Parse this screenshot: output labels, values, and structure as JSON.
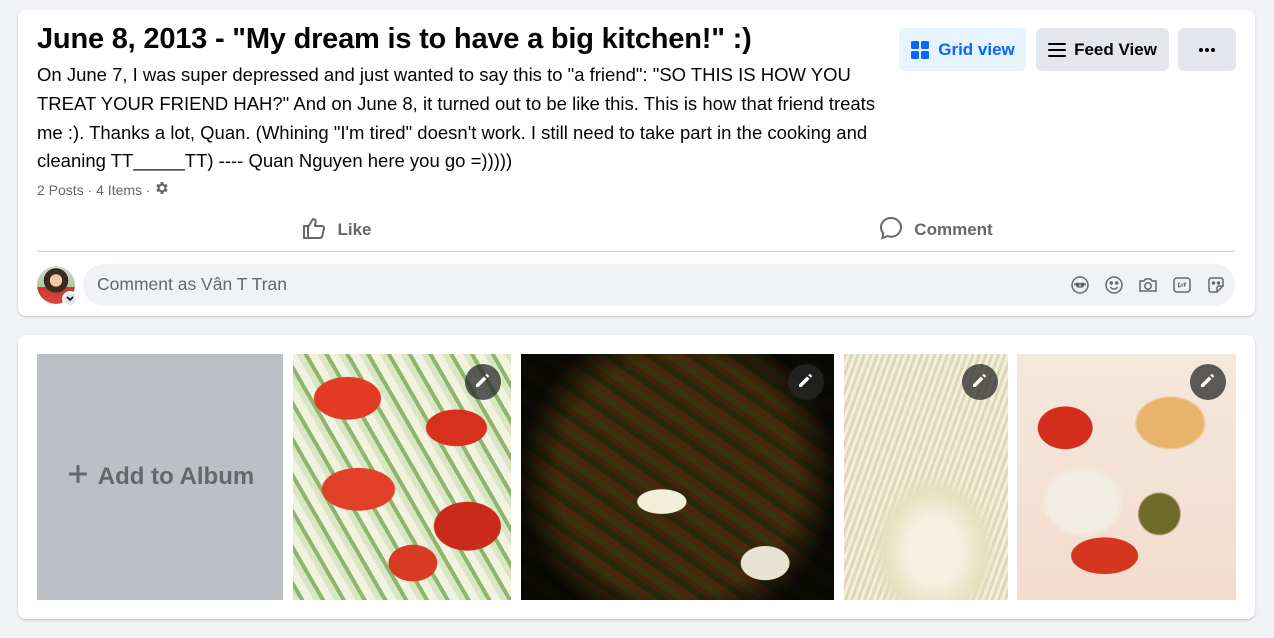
{
  "album": {
    "title": "June 8, 2013 - \"My dream is to have a big kitchen!\" :)",
    "description": "On June 7, I was super depressed and just wanted to say this to \"a friend\": \"SO THIS IS HOW YOU TREAT YOUR FRIEND HAH?\" And on June 8, it turned out to be like this. This is how that friend treats me :). Thanks a lot, Quan. (Whining \"I'm tired\" doesn't work. I still need to take part in the cooking and cleaning TT_____TT) ---- Quan Nguyen here you go =)))))",
    "meta": "2 Posts · 4 Items ·"
  },
  "view_buttons": {
    "grid": "Grid view",
    "feed": "Feed View"
  },
  "actions": {
    "like": "Like",
    "comment": "Comment"
  },
  "comment_box": {
    "placeholder": "Comment as Vân T Tran"
  },
  "grid": {
    "add_label": "Add to Album"
  },
  "icons": {
    "grid_view": "grid-icon",
    "feed_view": "list-icon",
    "more": "more-dots-icon",
    "like": "thumbs-up-icon",
    "comment": "comment-bubble-icon",
    "settings": "gear-icon",
    "avatar_chevron": "chevron-down-icon",
    "comment_tools": [
      "avatar-sticker-icon",
      "emoji-icon",
      "camera-icon",
      "gif-icon",
      "sticker-icon"
    ],
    "edit": "pencil-icon",
    "add": "plus-icon"
  },
  "colors": {
    "accent": "#0866ff",
    "accent_bg": "#e7f3ff",
    "secondary_text": "#65676b",
    "button_bg": "#e4e6eb",
    "page_bg": "#f0f2f5"
  }
}
